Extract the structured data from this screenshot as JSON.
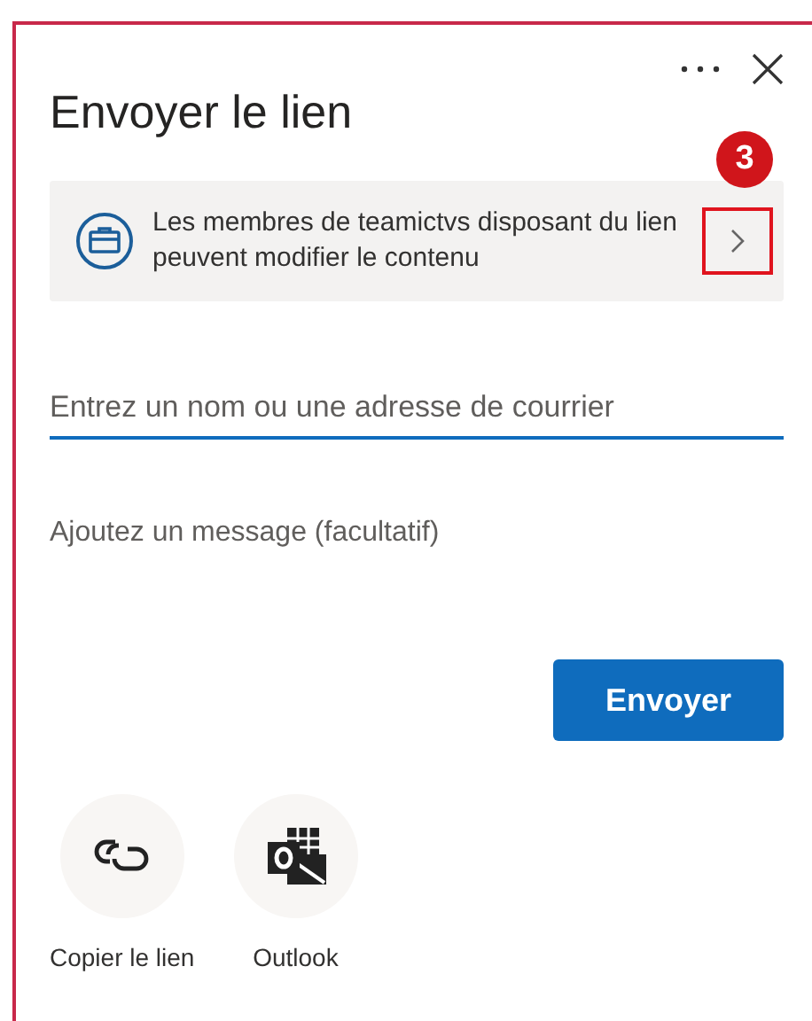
{
  "dialog": {
    "title": "Envoyer le lien"
  },
  "info": {
    "text": "Les membres de teamictvs disposant du lien peuvent modifier le contenu"
  },
  "callout": {
    "number": "3"
  },
  "recipient": {
    "placeholder": "Entrez un nom ou une adresse de courrier"
  },
  "message": {
    "placeholder": "Ajoutez un message (facultatif)"
  },
  "send_button": "Envoyer",
  "share_options": [
    {
      "kind": "link",
      "label": "Copier le lien"
    },
    {
      "kind": "outlook",
      "label": "Outlook"
    }
  ]
}
